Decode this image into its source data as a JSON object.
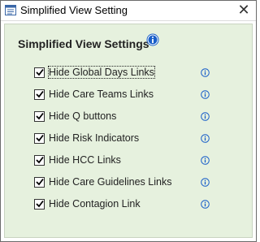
{
  "window": {
    "title": "Simplified View Setting",
    "close_glyph": "✕"
  },
  "panel": {
    "title": "Simplified View Settings",
    "info_icon": "info-circle-icon"
  },
  "options": [
    {
      "label": "Hide Global Days Links",
      "checked": true,
      "focused": true
    },
    {
      "label": "Hide Care Teams Links",
      "checked": true
    },
    {
      "label": "Hide Q buttons",
      "checked": true
    },
    {
      "label": "Hide Risk Indicators",
      "checked": true
    },
    {
      "label": "Hide HCC Links",
      "checked": true
    },
    {
      "label": "Hide Care Guidelines Links",
      "checked": true
    },
    {
      "label": "Hide Contagion Link",
      "checked": true
    }
  ],
  "colors": {
    "panel_bg": "#e6f1de",
    "info_blue": "#1a5fc9"
  }
}
